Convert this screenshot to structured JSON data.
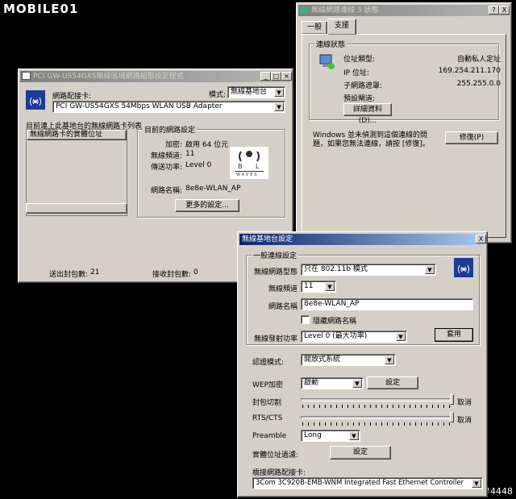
{
  "watermark": {
    "logo": "MOBILE01",
    "tag": "#4448"
  },
  "win_utility": {
    "title": "PCI GW-US54GXS無線區域網路組態設定程式",
    "adapter_label": "網路配接卡:",
    "mode_label": "模式:",
    "mode_value": "無線基地台",
    "adapter_value": "PCI GW-US54GXS 54Mbps WLAN USB Adapter",
    "list_caption": "目前連上此基地台的無線網路卡列表:",
    "list_header": "無線網路卡的實體位址",
    "current_title": "目前的網路設定",
    "encryption_label": "加密:",
    "encryption_value": "啟用 64 位元",
    "channel_label": "無線頻道:",
    "channel_value": "11",
    "power_label": "傳送功率:",
    "power_value": "Level 0",
    "ssid_label": "網路名稱:",
    "ssid_value": "8e8e-WLAN_AP",
    "more_button": "更多的設定...",
    "sent_label": "送出封包數:",
    "sent_value": "21",
    "recv_label": "接收封包數:",
    "recv_value": "0",
    "logo_text": "WAVES"
  },
  "win_status": {
    "title": "無線網路連線 3 狀態",
    "help_btn": "?",
    "close_btn": "X",
    "tabs": [
      "一般",
      "支援"
    ],
    "group_title": "連線狀態",
    "addr_type_label": "位址類型:",
    "addr_type_value": "自動私人定址",
    "ip_label": "IP 位址:",
    "ip_value": "169.254.211.170",
    "mask_label": "子網路遮罩:",
    "mask_value": "255.255.0.0",
    "gateway_label": "預設閘道:",
    "details_button": "詳細資料(D)...",
    "repair_text": "Windows 並未偵測到這個連線的問題，如果您無法連線，請按 [修復]。",
    "repair_button": "修復(P)"
  },
  "win_ap": {
    "title": "無線基地台設定",
    "close_btn": "X",
    "group_title": "一般連線設定",
    "type_label": "無線網路型態",
    "type_value": "只在 802.11b 模式",
    "channel_label": "無線頻道",
    "channel_value": "11",
    "ssid_label": "網路名稱",
    "ssid_value": "8e8e-WLAN_AP",
    "hide_label": "隱藏網路名稱",
    "power_label": "無線發射功率",
    "power_value": "Level 0 (最大功率)",
    "apply_button": "套用",
    "auth_label": "認證模式:",
    "auth_value": "開放式系統",
    "wep_label": "WEP加密",
    "wep_value": "啟動",
    "wep_button": "設定",
    "frag_label": "封包切割",
    "frag_value": "取消",
    "rts_label": "RTS/CTS",
    "rts_value": "取消",
    "frag_level": 1.0,
    "rts_level": 1.0,
    "preamble_label": "Preamble",
    "preamble_value": "Long",
    "mac_label": "實體位址過濾:",
    "mac_button": "設定",
    "bridge_label": "橋接網路配接卡:",
    "bridge_value": "3Com 3C920B-EMB-WNM Integrated Fast Ethernet Controller"
  }
}
